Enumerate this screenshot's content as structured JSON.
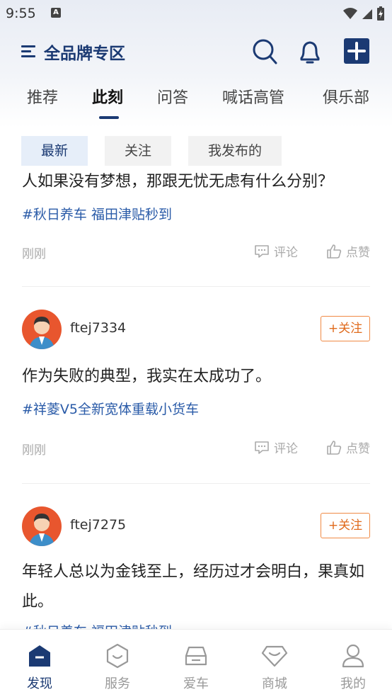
{
  "status_bar": {
    "time": "9:55",
    "notify_letter": "A"
  },
  "header": {
    "title": "全品牌专区"
  },
  "tabs": [
    {
      "label": "推荐",
      "active": false
    },
    {
      "label": "此刻",
      "active": true
    },
    {
      "label": "问答",
      "active": false
    },
    {
      "label": "喊话高管",
      "active": false
    },
    {
      "label": "俱乐部",
      "active": false
    }
  ],
  "filters": [
    {
      "label": "最新",
      "active": true
    },
    {
      "label": "关注",
      "active": false
    },
    {
      "label": "我发布的",
      "active": false
    }
  ],
  "posts": [
    {
      "content": "人如果没有梦想，那跟无忧无虑有什么分别？",
      "topic": "#秋日养车 福田津贴秒到",
      "time": "刚刚",
      "comment_label": "评论",
      "like_label": "点赞"
    },
    {
      "username": "ftej7334",
      "follow_label": "+关注",
      "content": "作为失败的典型，我实在太成功了。",
      "topic": "#祥菱V5全新宽体重载小货车",
      "time": "刚刚",
      "comment_label": "评论",
      "like_label": "点赞"
    },
    {
      "username": "ftej7275",
      "follow_label": "+关注",
      "content": "年轻人总以为金钱至上，经历过才会明白，果真如此。",
      "topic": "#秋日养车 福田津贴秒到"
    }
  ],
  "bottom_nav": [
    {
      "label": "发现",
      "icon": "discover-icon",
      "active": true
    },
    {
      "label": "服务",
      "icon": "service-icon",
      "active": false
    },
    {
      "label": "爱车",
      "icon": "car-icon",
      "active": false
    },
    {
      "label": "商城",
      "icon": "mall-icon",
      "active": false
    },
    {
      "label": "我的",
      "icon": "profile-icon",
      "active": false
    }
  ],
  "colors": {
    "brand": "#1b3a73",
    "topic": "#2a5ba8",
    "follow": "#e06a1c",
    "avatar_bg": "#e8562e"
  }
}
